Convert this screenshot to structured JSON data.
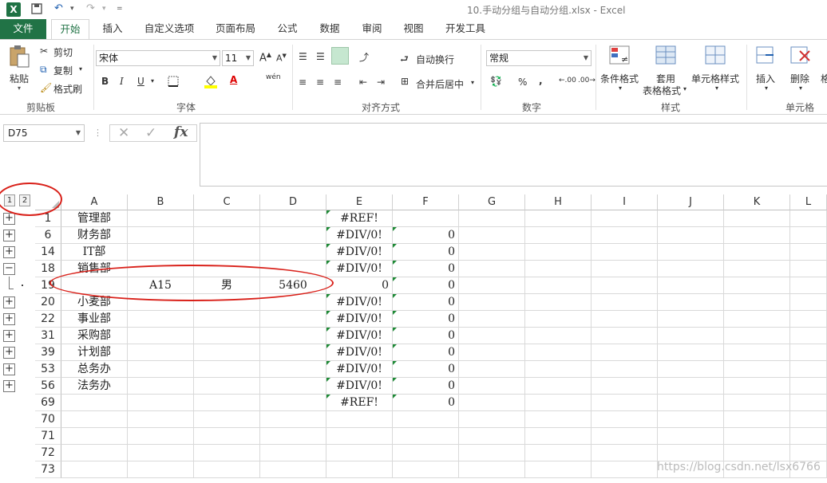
{
  "app": {
    "logo": "X",
    "title": "10.手动分组与自动分组.xlsx - Excel",
    "qat_icons": [
      "save-icon",
      "undo-icon",
      "redo-icon",
      "customize-icon"
    ]
  },
  "tabs": [
    {
      "label": "文件"
    },
    {
      "label": "开始"
    },
    {
      "label": "插入"
    },
    {
      "label": "自定义选项"
    },
    {
      "label": "页面布局"
    },
    {
      "label": "公式"
    },
    {
      "label": "数据"
    },
    {
      "label": "审阅"
    },
    {
      "label": "视图"
    },
    {
      "label": "开发工具"
    }
  ],
  "ribbon": {
    "clipboard": {
      "paste": "粘贴",
      "cut": "剪切",
      "copy": "复制",
      "format_painter": "格式刷",
      "group": "剪贴板"
    },
    "font": {
      "name": "宋体",
      "size": "11",
      "group": "字体",
      "bold": "B",
      "italic": "I",
      "underline": "U",
      "wen": "wén"
    },
    "alignment": {
      "wrap": "自动换行",
      "merge": "合并后居中",
      "group": "对齐方式"
    },
    "number": {
      "format": "常规",
      "group": "数字",
      "percent": "%",
      "comma": ","
    },
    "styles": {
      "conditional": "条件格式",
      "table_l1": "套用",
      "table_l2": "表格格式",
      "cell_styles": "单元格样式",
      "group": "样式"
    },
    "cells": {
      "insert": "插入",
      "delete": "删除",
      "format_partial": "格",
      "group": "单元格"
    }
  },
  "formula_bar": {
    "name_box": "D75",
    "fx": "fx",
    "value": ""
  },
  "outline": {
    "levels": [
      "1",
      "2"
    ]
  },
  "columns": [
    "A",
    "B",
    "C",
    "D",
    "E",
    "F",
    "G",
    "H",
    "I",
    "J",
    "K",
    "L"
  ],
  "rows": [
    {
      "num": "1",
      "a": "管理部",
      "b": "",
      "c": "",
      "d": "",
      "e": "#REF!",
      "f": "",
      "btn": "+"
    },
    {
      "num": "6",
      "a": "财务部",
      "b": "",
      "c": "",
      "d": "",
      "e": "#DIV/0!",
      "f": "0",
      "btn": "+"
    },
    {
      "num": "14",
      "a": "IT部",
      "b": "",
      "c": "",
      "d": "",
      "e": "#DIV/0!",
      "f": "0",
      "btn": "+"
    },
    {
      "num": "18",
      "a": "销售部",
      "b": "",
      "c": "",
      "d": "",
      "e": "#DIV/0!",
      "f": "0",
      "btn": "−"
    },
    {
      "num": "19",
      "a": "",
      "b": "A15",
      "c": "男",
      "d": "5460",
      "e": "0",
      "f": "0",
      "btn": ""
    },
    {
      "num": "20",
      "a": "小麦部",
      "b": "",
      "c": "",
      "d": "",
      "e": "#DIV/0!",
      "f": "0",
      "btn": "+"
    },
    {
      "num": "22",
      "a": "事业部",
      "b": "",
      "c": "",
      "d": "",
      "e": "#DIV/0!",
      "f": "0",
      "btn": "+"
    },
    {
      "num": "31",
      "a": "采购部",
      "b": "",
      "c": "",
      "d": "",
      "e": "#DIV/0!",
      "f": "0",
      "btn": "+"
    },
    {
      "num": "39",
      "a": "计划部",
      "b": "",
      "c": "",
      "d": "",
      "e": "#DIV/0!",
      "f": "0",
      "btn": "+"
    },
    {
      "num": "53",
      "a": "总务办",
      "b": "",
      "c": "",
      "d": "",
      "e": "#DIV/0!",
      "f": "0",
      "btn": "+"
    },
    {
      "num": "56",
      "a": "法务办",
      "b": "",
      "c": "",
      "d": "",
      "e": "#DIV/0!",
      "f": "0",
      "btn": "+"
    },
    {
      "num": "69",
      "a": "",
      "b": "",
      "c": "",
      "d": "",
      "e": "#REF!",
      "f": "0",
      "btn": ""
    },
    {
      "num": "70",
      "a": "",
      "b": "",
      "c": "",
      "d": "",
      "e": "",
      "f": "",
      "btn": ""
    },
    {
      "num": "71",
      "a": "",
      "b": "",
      "c": "",
      "d": "",
      "e": "",
      "f": "",
      "btn": ""
    },
    {
      "num": "72",
      "a": "",
      "b": "",
      "c": "",
      "d": "",
      "e": "",
      "f": "",
      "btn": ""
    },
    {
      "num": "73",
      "a": "",
      "b": "",
      "c": "",
      "d": "",
      "e": "",
      "f": "",
      "btn": ""
    }
  ],
  "watermark": "https://blog.csdn.net/lsx6766",
  "colors": {
    "accent": "#217346",
    "annotation": "#d9211a",
    "error_marker": "#1e8a36"
  }
}
